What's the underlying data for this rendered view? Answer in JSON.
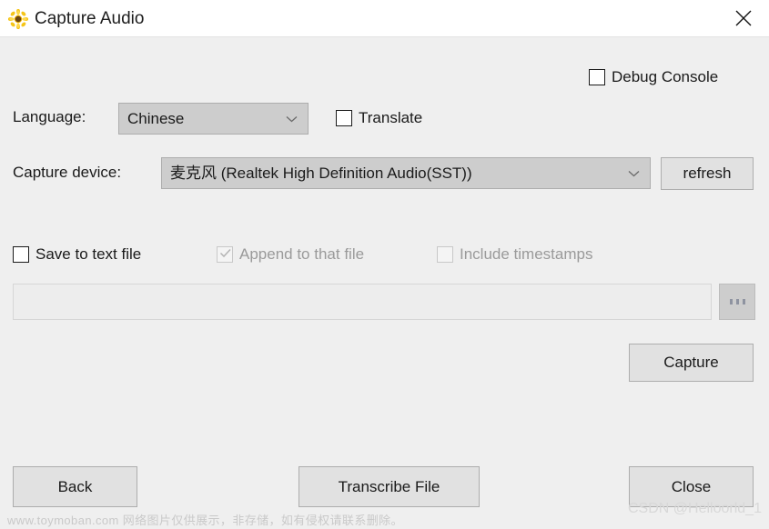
{
  "window": {
    "title": "Capture Audio",
    "icon": "sunflower-icon",
    "close_label": "✕"
  },
  "form": {
    "debug_console": {
      "label": "Debug Console",
      "checked": false,
      "enabled": true
    },
    "language": {
      "label": "Language:",
      "value": "Chinese"
    },
    "translate": {
      "label": "Translate",
      "checked": false,
      "enabled": true
    },
    "capture_device": {
      "label": "Capture device:",
      "value": "麦克风 (Realtek High Definition Audio(SST))"
    },
    "refresh_label": "refresh",
    "save_to_text_file": {
      "label": "Save to text file",
      "checked": false,
      "enabled": true
    },
    "append_to_that_file": {
      "label": "Append to that file",
      "checked": true,
      "enabled": false
    },
    "include_timestamps": {
      "label": "Include timestamps",
      "checked": false,
      "enabled": false
    },
    "path_field": {
      "value": "",
      "placeholder": ""
    },
    "browse_label": "...",
    "capture_label": "Capture"
  },
  "footer": {
    "back_label": "Back",
    "transcribe_label": "Transcribe File",
    "close_label": "Close"
  },
  "watermarks": {
    "left": "www.toymoban.com 网络图片仅供展示，非存储，如有侵权请联系删除。",
    "right": "CSDN @Helloorld_1"
  },
  "colors": {
    "window_bg": "#efefef",
    "titlebar_bg": "#ffffff",
    "combo_bg": "#cdcdcd",
    "button_bg": "#e1e1e1",
    "border": "#adadad",
    "disabled_text": "#9a9a9a"
  }
}
